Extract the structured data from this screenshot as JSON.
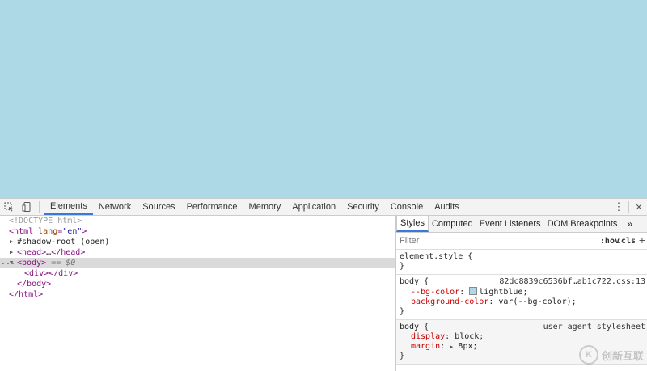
{
  "page": {
    "background_color": "#add8e6"
  },
  "toolbar": {
    "tabs": [
      "Elements",
      "Network",
      "Sources",
      "Performance",
      "Memory",
      "Application",
      "Security",
      "Console",
      "Audits"
    ],
    "active_tab": "Elements",
    "more_glyph": "⋮",
    "close_glyph": "✕"
  },
  "dom": {
    "doctype": "<!DOCTYPE html>",
    "html_open_tag": "html",
    "html_attr_name": "lang",
    "html_attr_value": "\"en\"",
    "shadow_root": "#shadow-root (open)",
    "head_tag": "head",
    "head_ellipsis": "…",
    "body_tag": "body",
    "selected_marker": "== $0",
    "div_tag": "div",
    "gutter_dots": "..."
  },
  "styles": {
    "subtabs": [
      "Styles",
      "Computed",
      "Event Listeners",
      "DOM Breakpoints"
    ],
    "subtabs_more": "»",
    "filter_placeholder": "Filter",
    "hov_label": ":hov",
    "cls_label": ".cls",
    "add_rule": "+",
    "element_style_selector": "element.style {",
    "close_brace": "}",
    "rule1": {
      "selector": "body {",
      "source": "82dc8839c6536bf…ab1c722.css:13",
      "decl1_name": "--bg-color",
      "decl1_value": "lightblue;",
      "decl2_name": "background-color",
      "decl2_value": "var(--bg-color);"
    },
    "rule2": {
      "selector": "body {",
      "source": "user agent stylesheet",
      "decl1_name": "display",
      "decl1_value": "block;",
      "decl2_name": "margin",
      "decl2_value": "8px;"
    }
  },
  "watermark": {
    "logo_letter": "K",
    "text": "创新互联"
  }
}
